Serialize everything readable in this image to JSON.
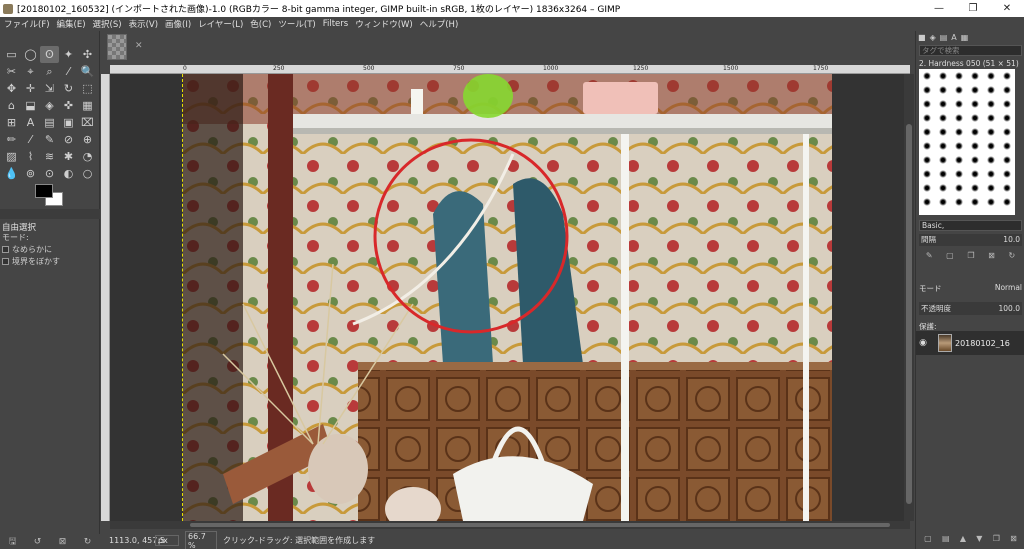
{
  "window": {
    "title": "[20180102_160532] (インポートされた画像)-1.0 (RGBカラー 8-bit gamma integer, GIMP built-in sRGB, 1枚のレイヤー) 1836x3264 – GIMP",
    "minimize": "—",
    "maximize": "❐",
    "close": "✕"
  },
  "menu": [
    "ファイル(F)",
    "編集(E)",
    "選択(S)",
    "表示(V)",
    "画像(I)",
    "レイヤー(L)",
    "色(C)",
    "ツール(T)",
    "Filters",
    "ウィンドウ(W)",
    "ヘルプ(H)"
  ],
  "toolbox": {
    "tools": [
      "▭",
      "◯",
      "ʘ",
      "✦",
      "✣",
      "✂",
      "⌖",
      "⌕",
      "⁄",
      "🔍",
      "✥",
      "✛",
      "⇲",
      "↻",
      "⬚",
      "⌂",
      "⬓",
      "◈",
      "✜",
      "▦",
      "⊞",
      "A",
      "▤",
      "▣",
      "⌧",
      "✏",
      "⁄",
      "✎",
      "⊘",
      "⊕",
      "▨",
      "⌇",
      "≋",
      "✱",
      "◔",
      "💧",
      "⊚",
      "⊙",
      "◐",
      "○"
    ],
    "active_tool_index": 2,
    "options_title": "自由選択",
    "mode_label": "モード:",
    "antialias_label": "なめらかに",
    "feather_label": "境界をぼかす"
  },
  "ruler": {
    "labels": [
      {
        "text": "0"
      },
      {
        "text": "250"
      },
      {
        "text": "500"
      },
      {
        "text": "750"
      },
      {
        "text": "1000"
      },
      {
        "text": "1250"
      },
      {
        "text": "1500"
      },
      {
        "text": "1750"
      }
    ]
  },
  "status": {
    "coord": "1113.0, 457.5",
    "unit": "px",
    "zoom": "66.7 %",
    "message": "クリック-ドラッグ: 選択範囲を作成します"
  },
  "dock": {
    "tabs": [
      "■",
      "◈",
      "▤",
      "A",
      "▦"
    ],
    "search_placeholder": "タグで検索",
    "brush_name": "2. Hardness 050 (51 × 51)",
    "preset": "Basic,",
    "spacing_label": "間隔",
    "spacing_value": "10.0",
    "mode_label": "モード",
    "mode_value": "Normal",
    "opacity_label": "不透明度",
    "opacity_value": "100.0",
    "lock_label": "保護:",
    "layer_name": "20180102_16"
  },
  "colors": {
    "accent": "#e8e000",
    "circle": "#d8282a"
  }
}
